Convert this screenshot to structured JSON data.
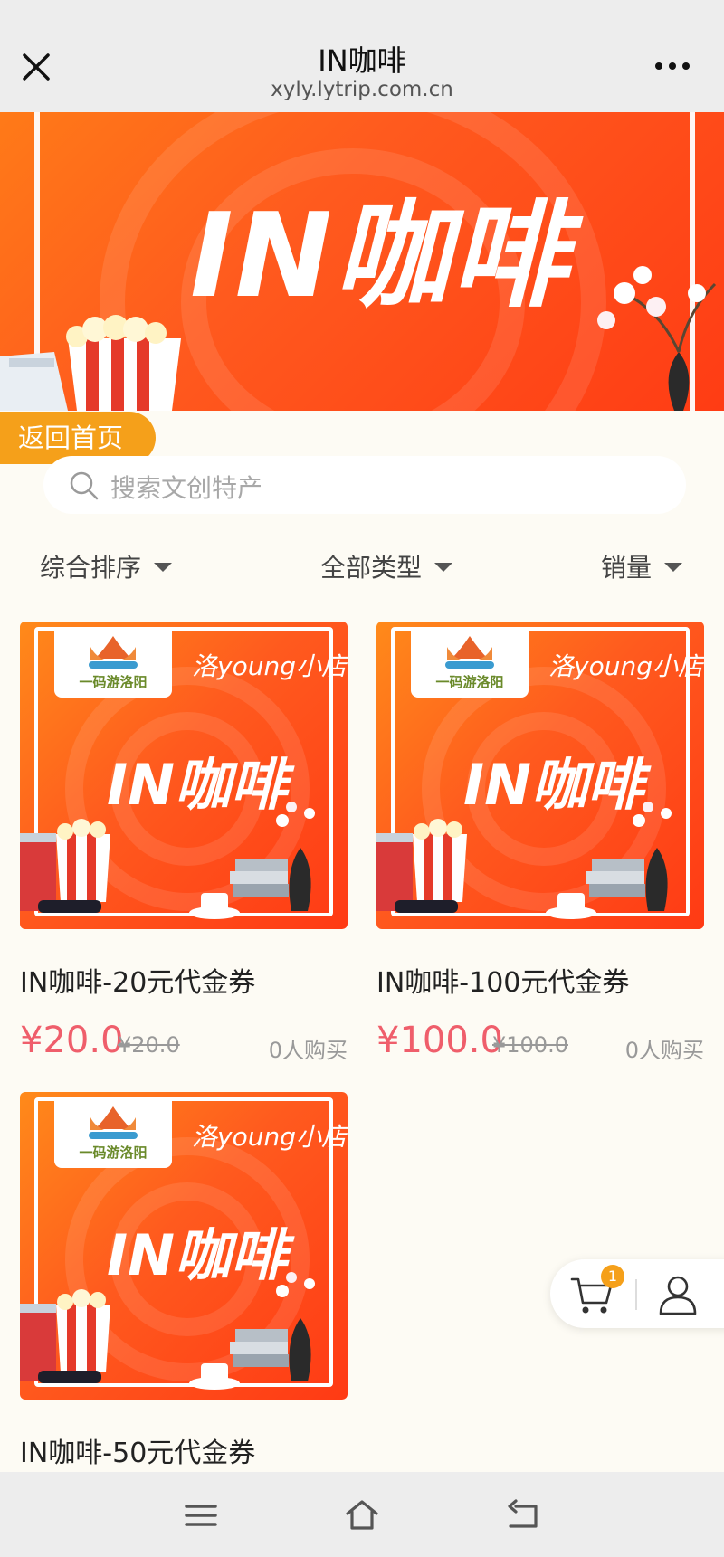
{
  "window": {
    "title": "IN咖啡",
    "url": "xyly.lytrip.com.cn",
    "close_icon": "close-icon",
    "more_icon": "more-icon"
  },
  "banner": {
    "text": "IN咖啡"
  },
  "back_home_label": "返回首页",
  "search": {
    "placeholder": "搜索文创特产"
  },
  "sort": {
    "general": "综合排序",
    "category": "全部类型",
    "sales": "销量"
  },
  "products": [
    {
      "shop": "洛young小店",
      "logo_text": "一码游洛阳",
      "image_text": "IN咖啡",
      "name": "IN咖啡-20元代金券",
      "price": "¥20.0",
      "old_price": "¥20.0",
      "buyers": "0人购买"
    },
    {
      "shop": "洛young小店",
      "logo_text": "一码游洛阳",
      "image_text": "IN咖啡",
      "name": "IN咖啡-100元代金券",
      "price": "¥100.0",
      "old_price": "¥100.0",
      "buyers": "0人购买"
    },
    {
      "shop": "洛young小店",
      "logo_text": "一码游洛阳",
      "image_text": "IN咖啡",
      "name": "IN咖啡-50元代金券"
    }
  ],
  "cart": {
    "badge": "1"
  },
  "colors": {
    "accent_orange": "#f5a01a",
    "price_red": "#ef5e6b",
    "banner_orange": "#ff5a1e"
  }
}
